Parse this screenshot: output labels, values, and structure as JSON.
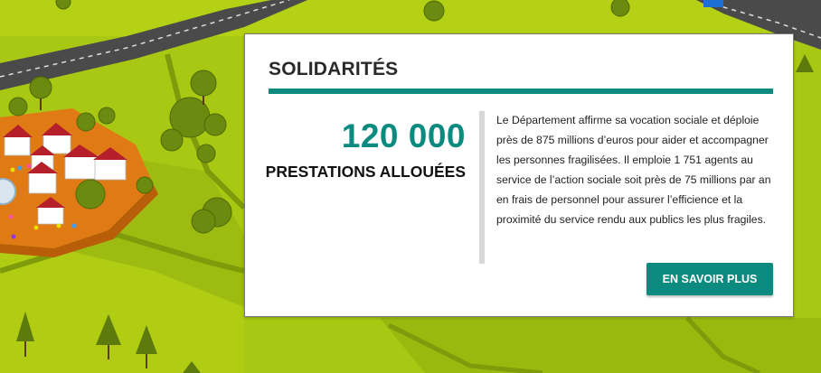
{
  "section": {
    "title": "SOLIDARITÉS",
    "stat_number": "120 000",
    "stat_label": "PRESTATIONS ALLOUÉES",
    "description": "Le Département affirme sa vocation sociale et déploie près de 875 millions d’euros pour aider et accompagner les personnes fragilisées. Il emploie 1 751 agents au service de l’action sociale soit près de 75 millions par an en frais de personnel pour assurer l’efficience et la proximité du service rendu aux publics les plus fragiles.",
    "button_label": "EN SAVOIR PLUS"
  },
  "colors": {
    "accent": "#0b8a7f",
    "grass": "#a9c813",
    "road": "#4a4a4a",
    "village": "#e07a14"
  },
  "background": {
    "description_icon": "isometric-village-map-illustration"
  }
}
